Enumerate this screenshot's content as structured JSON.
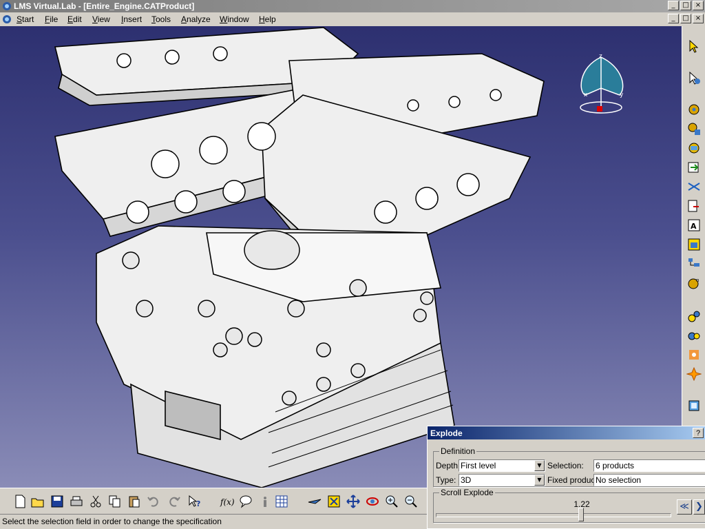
{
  "window": {
    "title": "LMS Virtual.Lab - [Entire_Engine.CATProduct]",
    "buttons": [
      "_",
      "□",
      "×"
    ]
  },
  "menubar": {
    "items": [
      {
        "label": "Start",
        "accel": "S",
        "rest": "tart"
      },
      {
        "label": "File",
        "accel": "F",
        "rest": "ile"
      },
      {
        "label": "Edit",
        "accel": "E",
        "rest": "dit"
      },
      {
        "label": "View",
        "accel": "V",
        "rest": "iew"
      },
      {
        "label": "Insert",
        "accel": "I",
        "rest": "nsert"
      },
      {
        "label": "Tools",
        "accel": "T",
        "rest": "ools"
      },
      {
        "label": "Analyze",
        "accel": "A",
        "rest": "nalyze"
      },
      {
        "label": "Window",
        "accel": "W",
        "rest": "indow"
      },
      {
        "label": "Help",
        "accel": "H",
        "rest": "elp"
      }
    ]
  },
  "compass": {
    "axis_x": "x",
    "axis_y": "y",
    "axis_z": "z"
  },
  "status": {
    "text": "Select the selection field in order to change the specification"
  },
  "dialog": {
    "title": "Explode",
    "help": "?",
    "definition": {
      "label": "Definition",
      "depth_label": "Depth:",
      "depth_value": "First level",
      "selection_label": "Selection:",
      "selection_value": "6 products",
      "type_label": "Type:",
      "type_value": "3D",
      "fixed_label": "Fixed product:",
      "fixed_value": "No selection"
    },
    "scroll": {
      "label": "Scroll Explode",
      "value": "1.22",
      "position": 0.62,
      "first_button": "≪",
      "next_button": "❯"
    }
  },
  "colors": {
    "title_inactive": "#8a8a8a",
    "dialog_title": "#0a246a",
    "viewport_top": "#2d3070",
    "viewport_bottom": "#8a8cb7"
  }
}
